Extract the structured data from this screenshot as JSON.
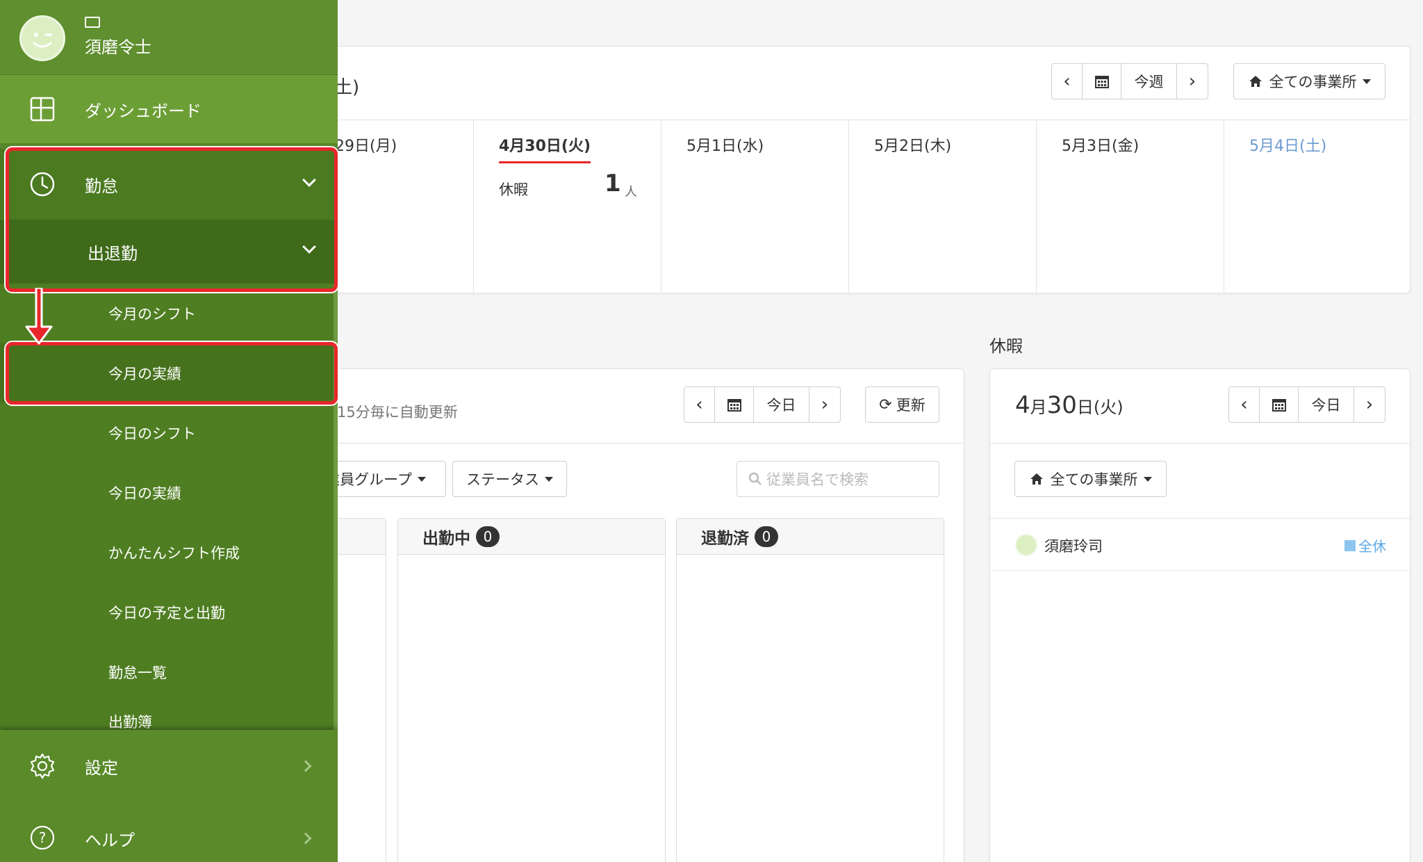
{
  "week_card": {
    "title_fragment": "土)",
    "nav": {
      "prev": "‹",
      "calendar_icon": "calendar-icon",
      "current": "今週",
      "next": "›"
    },
    "office_filter": "全ての事業所",
    "days": [
      {
        "label": "29日(月)"
      },
      {
        "label": "4月30日(火)",
        "highlight_color": "#e8262b",
        "stat_label": "休暇",
        "stat_value": "1",
        "stat_unit": "人"
      },
      {
        "label": "5月1日(水)"
      },
      {
        "label": "5月2日(木)"
      },
      {
        "label": "5月3日(金)"
      },
      {
        "label": "5月4日(土)",
        "color": "#6b9bd1"
      }
    ]
  },
  "today_card": {
    "auto_refresh": "15分毎に自動更新",
    "nav": {
      "prev": "‹",
      "current": "今日",
      "next": "›"
    },
    "refresh_label": "更新",
    "group_filter": "業員グループ",
    "status_filter": "ステータス",
    "search_placeholder": "従業員名で検索",
    "columns": [
      {
        "title": "出勤中",
        "count": "0"
      },
      {
        "title": "退勤済",
        "count": "0"
      }
    ]
  },
  "leave_card": {
    "section_title": "休暇",
    "date_big": "4",
    "date_month": "月",
    "date_day": "30",
    "date_suffix": "日(火)",
    "nav": {
      "prev": "‹",
      "current": "今日",
      "next": "›"
    },
    "office_filter": "全ての事業所",
    "entries": [
      {
        "name": "須磨玲司",
        "badge": "全休",
        "badge_color": "#5aa8e6"
      }
    ]
  },
  "sidebar": {
    "user_name": "須磨令士",
    "dashboard": "ダッシュボード",
    "attendance": "勤怠",
    "clock_in_out": "出退勤",
    "sub_items": [
      "今月のシフト",
      "今月の実績",
      "今日のシフト",
      "今日の実績",
      "かんたんシフト作成",
      "今日の予定と出勤",
      "勤怠一覧",
      "出勤簿"
    ],
    "settings": "設定",
    "help": "ヘルプ"
  }
}
